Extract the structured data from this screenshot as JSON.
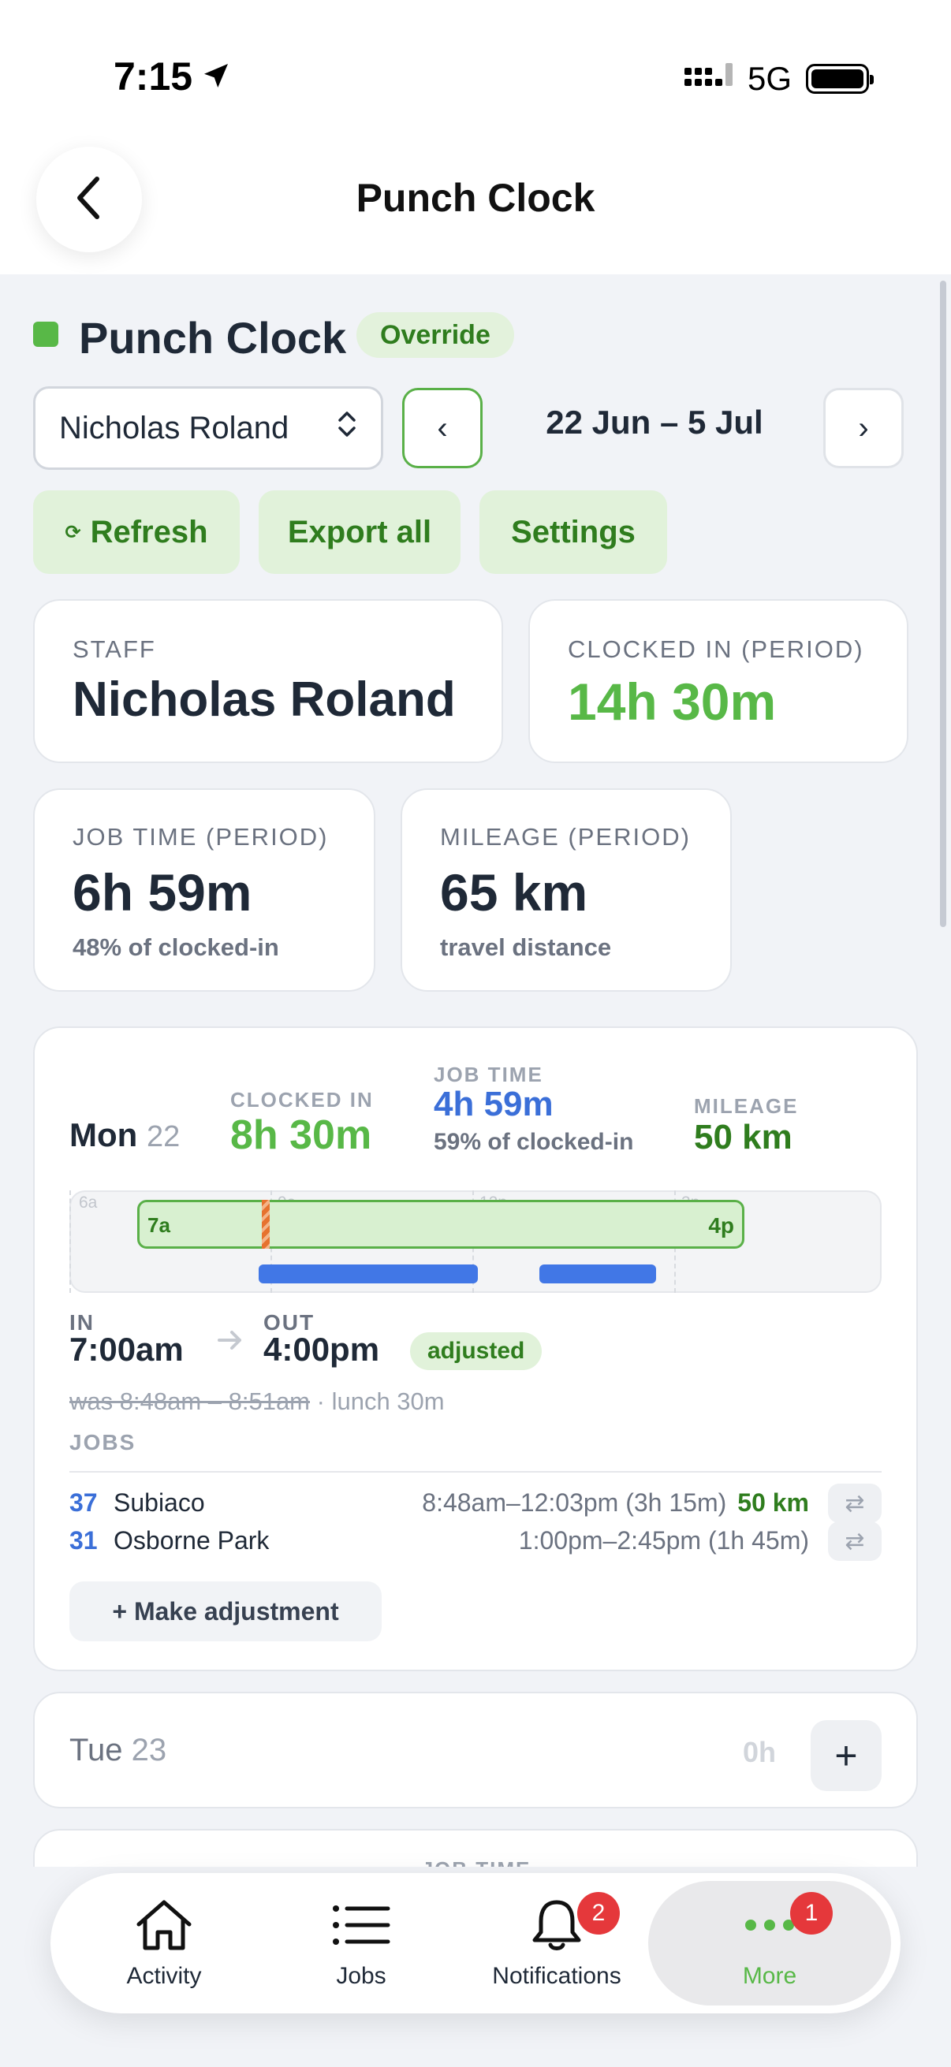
{
  "status_bar": {
    "time": "7:15",
    "network": "5G"
  },
  "nav": {
    "title": "Punch Clock"
  },
  "page": {
    "title": "Punch Clock",
    "badge": "Override"
  },
  "controls": {
    "staff_select": "Nicholas Roland",
    "prev": "‹",
    "next": "›",
    "date_range": "22 Jun – 5 Jul",
    "refresh": "Refresh",
    "export_all": "Export all",
    "settings": "Settings"
  },
  "stats": {
    "staff": {
      "label": "STAFF",
      "value": "Nicholas Roland"
    },
    "clocked_in": {
      "label": "CLOCKED IN (PERIOD)",
      "value": "14h 30m"
    },
    "job_time": {
      "label": "JOB TIME (PERIOD)",
      "value": "6h 59m",
      "sub": "48% of clocked-in"
    },
    "mileage": {
      "label": "MILEAGE (PERIOD)",
      "value": "65 km",
      "sub": "travel distance"
    }
  },
  "days": [
    {
      "day": "Mon",
      "num": "22",
      "clocked_in_label": "CLOCKED IN",
      "clocked_in": "8h 30m",
      "job_time_label": "JOB TIME",
      "job_time": "4h 59m",
      "job_time_sub": "59% of clocked-in",
      "mileage_label": "MILEAGE",
      "mileage": "50 km",
      "timeline": {
        "ticks": [
          "6a",
          "9a",
          "12p",
          "3p"
        ],
        "shift_start_label": "7a",
        "shift_end_label": "4p"
      },
      "in_label": "IN",
      "in": "7:00am",
      "out_label": "OUT",
      "out": "4:00pm",
      "adjusted": "adjusted",
      "was": "was 8:48am – 8:51am",
      "lunch": "· lunch 30m",
      "jobs_label": "JOBS",
      "jobs": [
        {
          "num": "37",
          "place": "Subiaco",
          "time": "8:48am–12:03pm (3h 15m)",
          "km": "50 km"
        },
        {
          "num": "31",
          "place": "Osborne Park",
          "time": "1:00pm–2:45pm (1h 45m)",
          "km": ""
        }
      ],
      "adjust_button": "+ Make adjustment"
    },
    {
      "day": "Tue",
      "num": "23",
      "hours": "0h",
      "add": "+"
    }
  ],
  "next_card_peek": "JOB TIME",
  "tabs": [
    {
      "label": "Activity",
      "icon": "home-icon"
    },
    {
      "label": "Jobs",
      "icon": "list-icon"
    },
    {
      "label": "Notifications",
      "icon": "bell-icon",
      "badge": "2"
    },
    {
      "label": "More",
      "icon": "more-icon",
      "badge": "1",
      "active": true
    }
  ],
  "colors": {
    "accent_green": "#58b847",
    "dark_green": "#2f7d1e",
    "job_blue": "#3b6fd8",
    "badge_red": "#e5383b"
  }
}
